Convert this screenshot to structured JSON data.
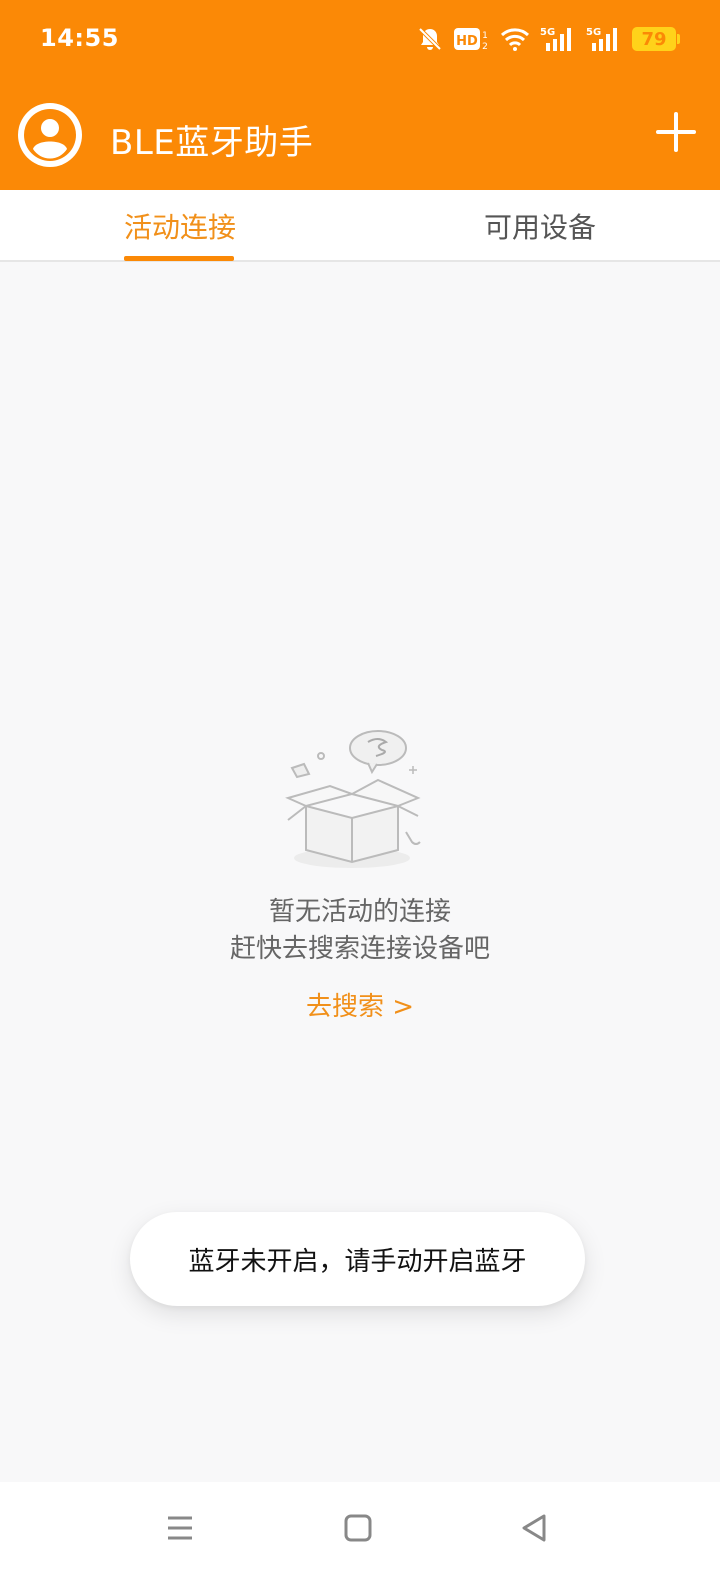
{
  "status": {
    "time": "14:55",
    "battery": "79",
    "network_1": "5G",
    "network_2": "5G",
    "hd": "HD"
  },
  "appbar": {
    "title": "BLE蓝牙助手"
  },
  "tabs": [
    {
      "label": "活动连接",
      "active": true
    },
    {
      "label": "可用设备",
      "active": false
    }
  ],
  "empty_state": {
    "title": "暂无活动的连接",
    "subtitle": "赶快去搜索连接设备吧",
    "link": "去搜索 >"
  },
  "toast": {
    "message": "蓝牙未开启，请手动开启蓝牙"
  },
  "colors": {
    "primary": "#fb8906",
    "accent_text": "#f1901a",
    "battery": "#ffd21a"
  }
}
